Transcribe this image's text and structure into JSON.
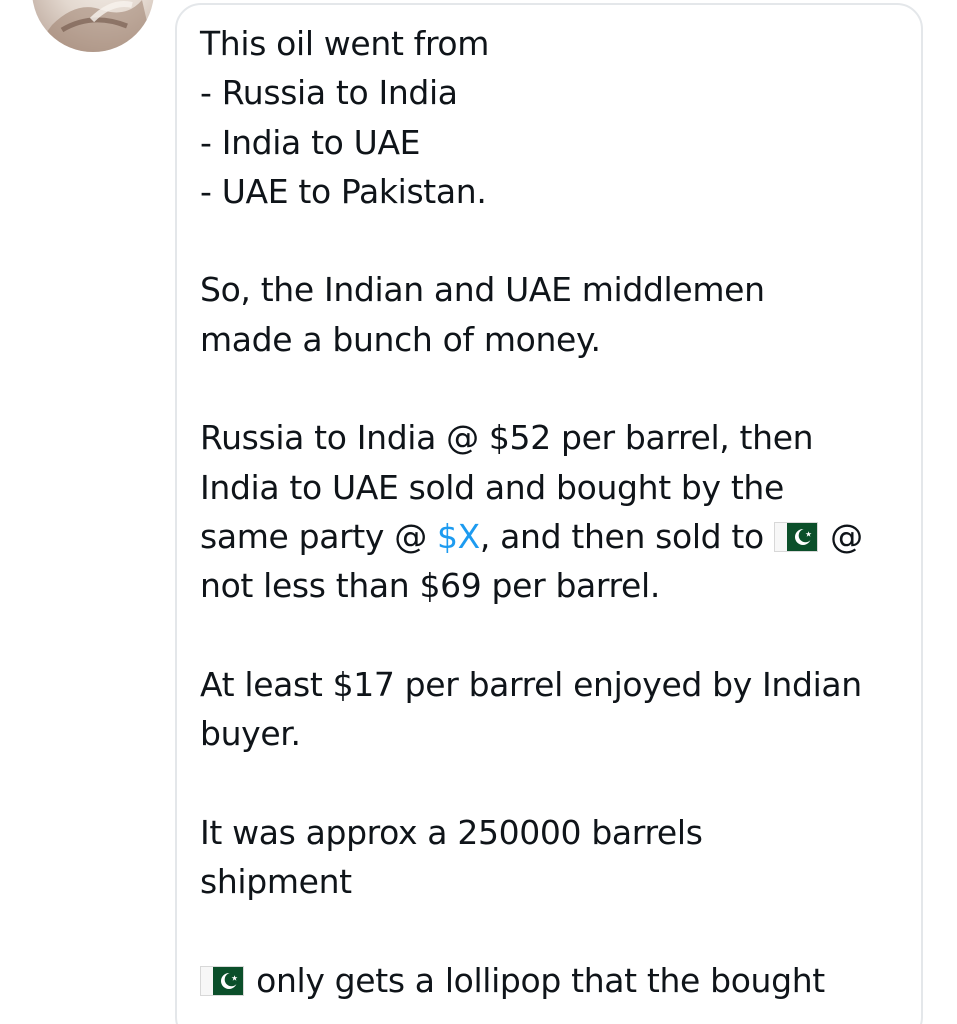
{
  "tweet": {
    "lines": {
      "l1": "This oil went from",
      "l2": "- Russia to India",
      "l3": "- India to UAE",
      "l4": "- UAE to Pakistan.",
      "l5": "So, the Indian and UAE middlemen",
      "l6": "made a bunch of money.",
      "l7": "Russia to India @ $52 per barrel, then",
      "l8": "India to UAE sold and bought by the",
      "l9_pre": "same party @ ",
      "l9_link": "$X",
      "l9_post": ", and then sold to ",
      "l9_end": " @",
      "l10": "not less than $69 per barrel.",
      "l11": "At least $17 per barrel enjoyed by Indian",
      "l12": "buyer.",
      "l13": "It was approx a 250000 barrels",
      "l14": "shipment",
      "l15_post": " only gets a lollipop that the bought"
    },
    "emoji": "pakistan-flag-icon",
    "colors": {
      "text": "#0f1419",
      "link": "#1d9bf0",
      "border": "#e4e7ea",
      "flag_green": "#0b4f2a"
    }
  }
}
